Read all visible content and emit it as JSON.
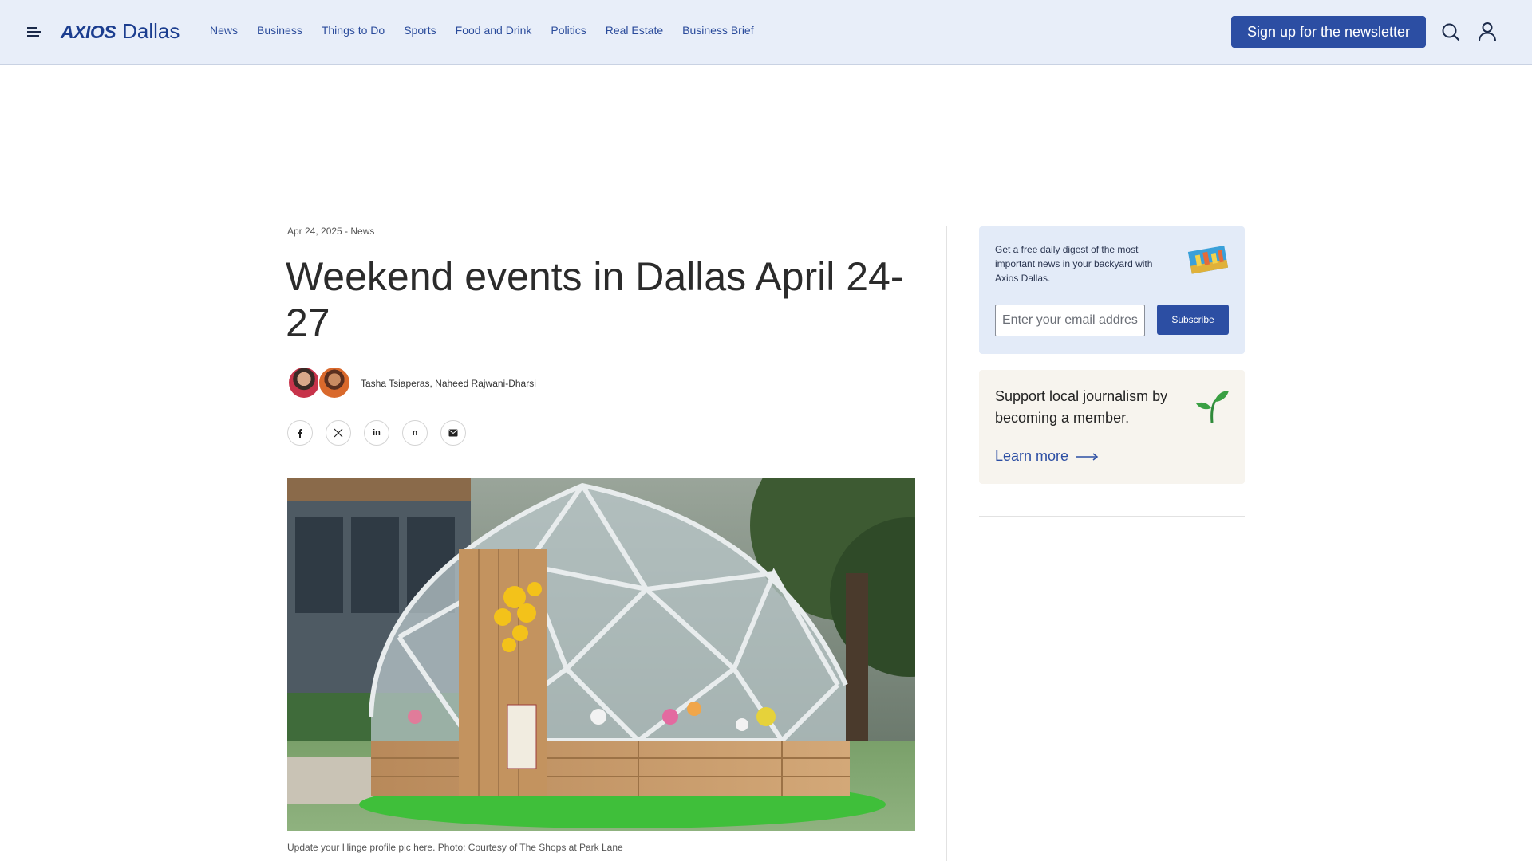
{
  "brand": {
    "name": "AXIOS",
    "city": "Dallas"
  },
  "nav": [
    {
      "label": "News"
    },
    {
      "label": "Business"
    },
    {
      "label": "Things to Do"
    },
    {
      "label": "Sports"
    },
    {
      "label": "Food and Drink"
    },
    {
      "label": "Politics"
    },
    {
      "label": "Real Estate"
    },
    {
      "label": "Business Brief"
    }
  ],
  "header": {
    "signup_label": "Sign up for the newsletter",
    "menu_icon": "menu-icon",
    "search_icon": "search-icon",
    "account_icon": "user-icon"
  },
  "article": {
    "dateline": "Apr 24, 2025 - News",
    "headline": "Weekend events in Dallas April 24-27",
    "authors": "Tasha Tsiaperas, Naheed Rajwani-Dharsi",
    "share_icons": [
      "facebook-icon",
      "x-icon",
      "linkedin-icon",
      "threads-icon",
      "email-icon"
    ],
    "share_labels": [
      "f",
      "X",
      "in",
      "n",
      "✉"
    ],
    "caption": "Update your Hinge profile pic here. Photo: Courtesy of The Shops at Park Lane"
  },
  "sidebar": {
    "newsletter_text": "Get a free daily digest of the most important news in your backyard with Axios Dallas.",
    "email_placeholder": "Enter your email address",
    "subscribe_label": "Subscribe",
    "member_text": "Support local journalism by becoming a member.",
    "learn_more_label": "Learn more"
  },
  "colors": {
    "header_bg": "#e8eef9",
    "accent": "#2c4ea3",
    "brand_text": "#1b3d8f",
    "newsletter_card_bg": "#e3ebf8",
    "member_card_bg": "#f7f4ee"
  }
}
